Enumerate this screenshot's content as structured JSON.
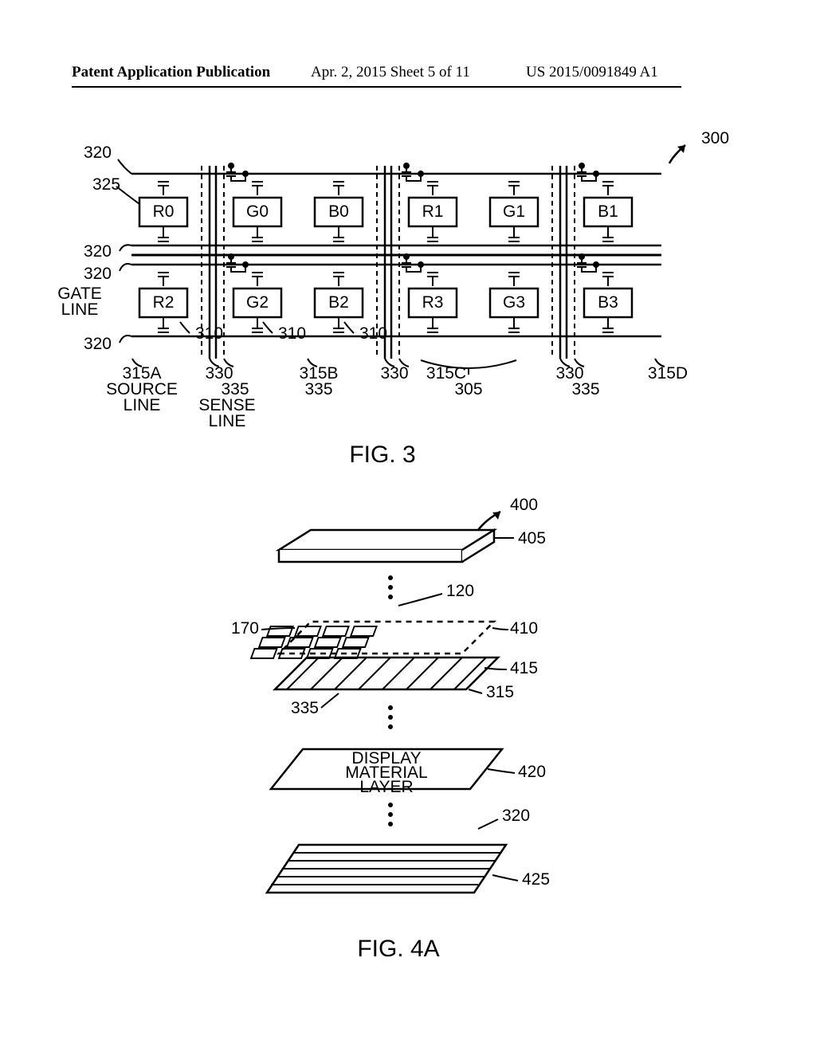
{
  "header": {
    "left": "Patent Application Publication",
    "center": "Apr. 2, 2015  Sheet 5 of 11",
    "right": "US 2015/0091849 A1"
  },
  "fig3": {
    "caption": "FIG. 3",
    "ref300": "300",
    "ref320_1": "320",
    "ref325": "325",
    "ref320_2": "320",
    "ref320_3": "320",
    "gate_line": "GATE\nLINE",
    "ref320_4": "320",
    "ref310_1": "310",
    "ref310_2": "310",
    "ref310_3": "310",
    "ref315A": "315A",
    "source_line": "SOURCE\nLINE",
    "ref330_1": "330",
    "ref335_1": "335",
    "sense_line": "SENSE\nLINE",
    "ref315B": "315B",
    "ref335_2": "335",
    "ref330_2": "330",
    "ref315C": "315C",
    "ref330_3": "330",
    "ref335_3": "335",
    "ref315D": "315D",
    "ref305": "305",
    "pixels": [
      "R0",
      "G0",
      "B0",
      "R1",
      "G1",
      "B1",
      "R2",
      "G2",
      "B2",
      "R3",
      "G3",
      "B3"
    ]
  },
  "fig4": {
    "caption": "FIG. 4A",
    "ref400": "400",
    "ref405": "405",
    "ref120": "120",
    "ref170": "170",
    "ref410": "410",
    "ref415": "415",
    "ref315": "315",
    "ref335": "335",
    "display_label": "DISPLAY\nMATERIAL\nLAYER",
    "ref420": "420",
    "ref320": "320",
    "ref425": "425"
  }
}
